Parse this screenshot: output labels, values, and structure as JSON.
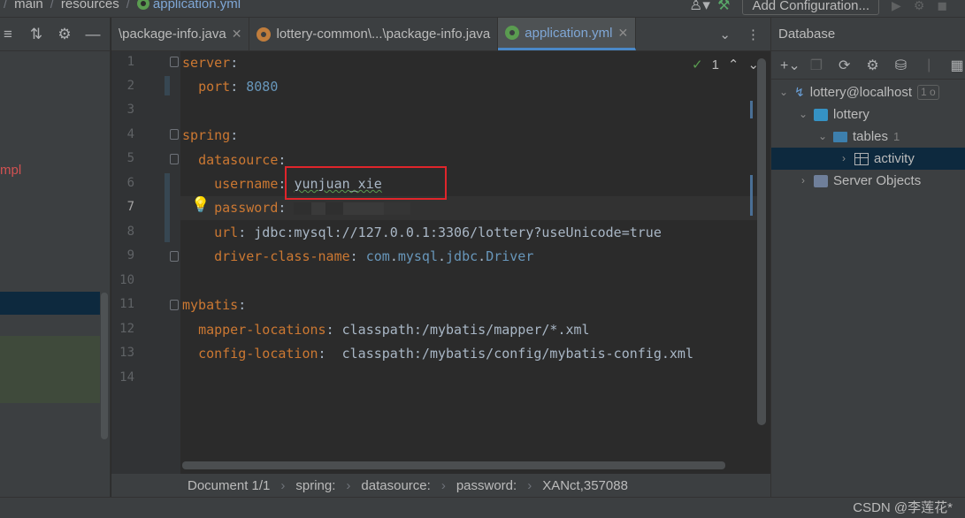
{
  "breadcrumb": {
    "items": [
      "main",
      "resources"
    ],
    "file": "application.yml"
  },
  "run": {
    "add_config_label": "Add Configuration..."
  },
  "left_panel": {
    "impl_text": "mpl"
  },
  "tabs": [
    {
      "label": "\\package-info.java",
      "icon": "java-class-icon",
      "active": false
    },
    {
      "label": "lottery-common\\...\\package-info.java",
      "icon": "java-class-icon",
      "active": false
    },
    {
      "label": "application.yml",
      "icon": "yml-file-icon",
      "active": true
    }
  ],
  "editor": {
    "inspection_count": "1",
    "line_numbers": [
      "1",
      "2",
      "3",
      "4",
      "5",
      "6",
      "7",
      "8",
      "9",
      "10",
      "11",
      "12",
      "13",
      "14"
    ],
    "current_line": "7",
    "lines": {
      "l1_key": "server",
      "l2_key": "port",
      "l2_val": "8080",
      "l4_key": "spring",
      "l5_key": "datasource",
      "l6_key": "username",
      "l6_val": "yunjuan_xie",
      "l7_key": "password",
      "l8_key": "url",
      "l8_val": "jdbc:mysql://127.0.0.1:3306/lottery?useUnicode=true",
      "l9_key": "driver-class-name",
      "l9_pkg1": "com",
      "l9_pkg2": "mysql",
      "l9_pkg3": "jdbc",
      "l9_cls": "Driver",
      "l11_key": "mybatis",
      "l12_key": "mapper-locations",
      "l12_val": "classpath:/mybatis/mapper/*.xml",
      "l13_key": "config-location",
      "l13_val": "classpath:/mybatis/config/mybatis-config.xml"
    }
  },
  "status_breadcrumb": [
    "Document 1/1",
    "spring:",
    "datasource:",
    "password:",
    "XANct,357088"
  ],
  "database": {
    "title": "Database",
    "tree": {
      "datasource": "lottery@localhost",
      "datasource_badge": "1 o",
      "schema": "lottery",
      "folder": "tables",
      "folder_count": "1",
      "table": "activity",
      "server_objects": "Server Objects"
    }
  },
  "watermark": "CSDN @李莲花*"
}
